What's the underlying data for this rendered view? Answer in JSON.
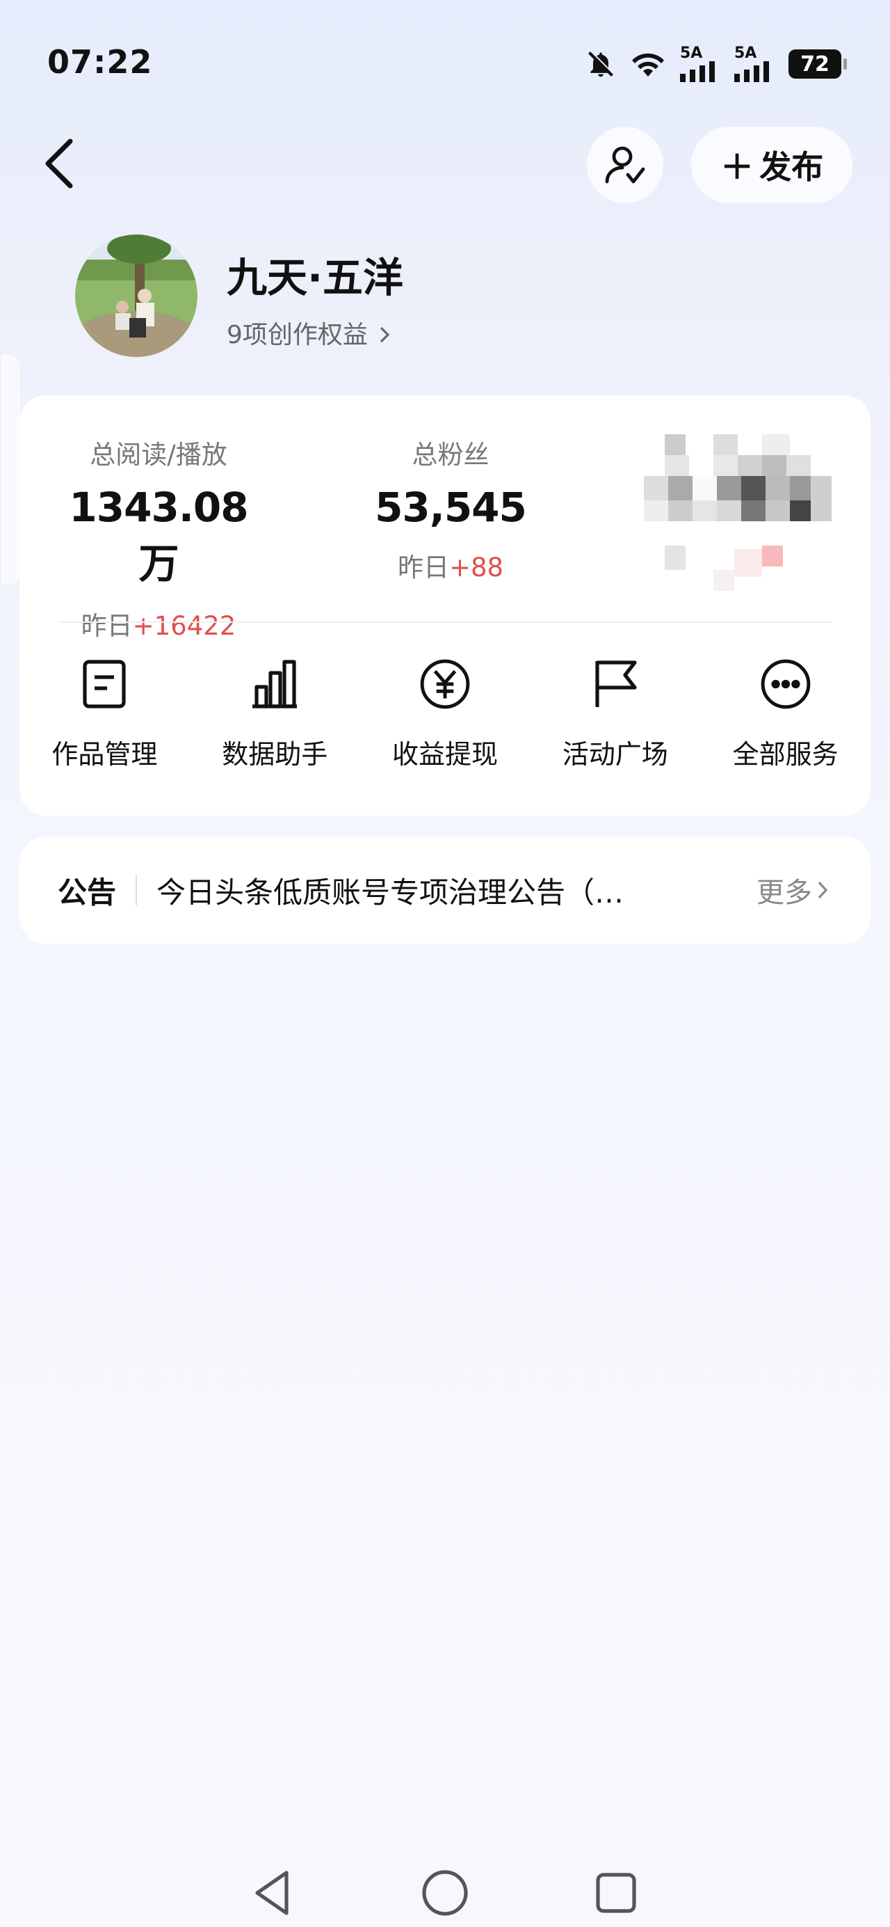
{
  "status_bar": {
    "time": "07:22",
    "network_1": "5A",
    "network_2": "5A",
    "battery": "72",
    "icons": [
      "bell-off-icon",
      "wifi-icon",
      "signal-icon",
      "signal-icon",
      "battery-icon"
    ]
  },
  "nav": {
    "publish_label": "发布",
    "publish_icon": "plus-icon"
  },
  "profile": {
    "name": "九天·五洋",
    "benefits": "9项创作权益"
  },
  "stats": [
    {
      "label": "总阅读/播放",
      "value": "1343.08万",
      "delta_prefix": "昨日",
      "delta": "+16422"
    },
    {
      "label": "总粉丝",
      "value": "53,545",
      "delta_prefix": "昨日",
      "delta": "+88"
    }
  ],
  "services": [
    {
      "label": "作品管理",
      "icon": "document-icon"
    },
    {
      "label": "数据助手",
      "icon": "bar-chart-icon"
    },
    {
      "label": "收益提现",
      "icon": "yuan-icon"
    },
    {
      "label": "活动广场",
      "icon": "flag-icon"
    },
    {
      "label": "全部服务",
      "icon": "more-icon"
    }
  ],
  "notice": {
    "tag": "公告",
    "text": "今日头条低质账号专项治理公告（…",
    "more": "更多"
  },
  "colors": {
    "positive": "#e0504d",
    "muted": "#777777"
  }
}
